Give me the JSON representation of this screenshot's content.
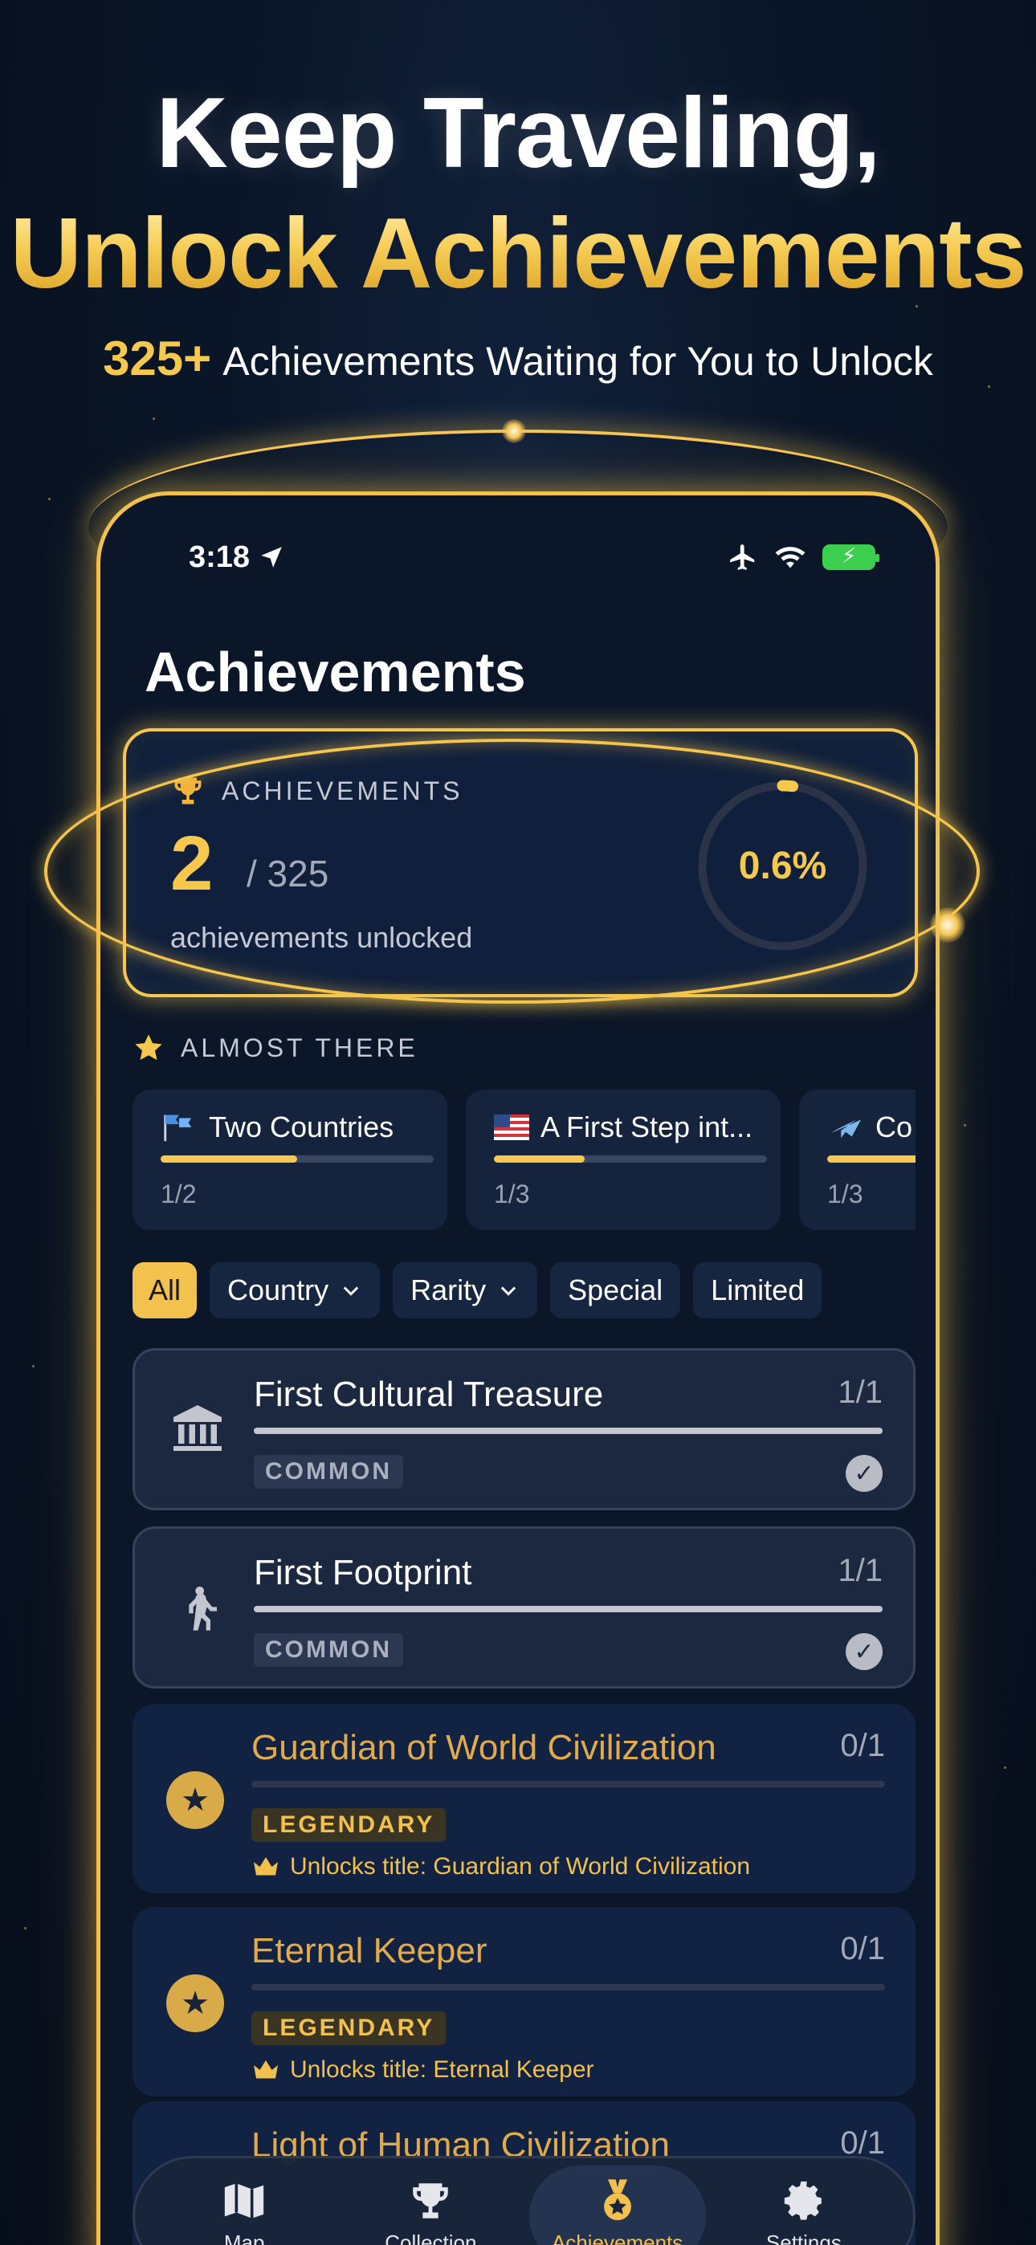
{
  "hero": {
    "line1": "Keep Traveling,",
    "line2": "Unlock Achievements",
    "sub_count": "325+",
    "sub_text": "Achievements Waiting for You to Unlock"
  },
  "status_bar": {
    "time": "3:18"
  },
  "page": {
    "title": "Achievements"
  },
  "summary": {
    "label": "ACHIEVEMENTS",
    "unlocked": "2",
    "total": "/ 325",
    "description": "achievements unlocked",
    "percent_text": "0.6%",
    "progress": 0.006
  },
  "almost_there": {
    "label": "ALMOST THERE",
    "items": [
      {
        "title": "Two Countries",
        "progress_text": "1/2",
        "progress": 0.5,
        "icon": "flags-icon"
      },
      {
        "title": "A First Step int...",
        "progress_text": "1/3",
        "progress": 0.3333,
        "icon": "us-flag-icon"
      },
      {
        "title": "Co",
        "progress_text": "1/3",
        "progress": 0.3333,
        "icon": "plane-icon"
      }
    ]
  },
  "filters": [
    {
      "label": "All",
      "active": true
    },
    {
      "label": "Country",
      "dropdown": true
    },
    {
      "label": "Rarity",
      "dropdown": true
    },
    {
      "label": "Special"
    },
    {
      "label": "Limited"
    }
  ],
  "achievements": [
    {
      "name": "First Cultural Treasure",
      "count": "1/1",
      "rarity": "COMMON",
      "icon": "museum-icon",
      "progress": 1.0
    },
    {
      "name": "First Footprint",
      "count": "1/1",
      "rarity": "COMMON",
      "icon": "walking-person-icon",
      "progress": 1.0
    },
    {
      "name": "Guardian of World Civilization",
      "count": "0/1",
      "rarity": "LEGENDARY",
      "icon": "star-medal-icon",
      "progress": 0,
      "unlock_text": "Unlocks title: Guardian of World Civilization"
    },
    {
      "name": "Eternal Keeper",
      "count": "0/1",
      "rarity": "LEGENDARY",
      "icon": "star-medal-icon",
      "progress": 0,
      "unlock_text": "Unlocks title: Eternal Keeper"
    },
    {
      "name": "Light of Human Civilization",
      "count": "0/1"
    }
  ],
  "tabs": [
    {
      "label": "Map",
      "icon": "map-icon"
    },
    {
      "label": "Collection",
      "icon": "trophy-icon"
    },
    {
      "label": "Achievements",
      "icon": "medal-icon",
      "active": true
    },
    {
      "label": "Settings",
      "icon": "gear-icon"
    }
  ],
  "colors": {
    "gold": "#f6c94e",
    "background": "#0a1628",
    "card": "#1b2840"
  }
}
